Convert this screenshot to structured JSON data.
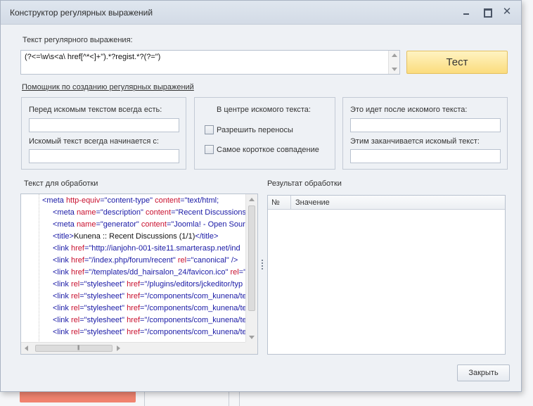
{
  "window": {
    "title": "Конструктор регулярных выражений"
  },
  "regex": {
    "label": "Текст регулярного выражения:",
    "value": "(?<=\\w\\s<a\\ href[^*<]+\").*?regist.*?(?=\")",
    "test_button": "Тест"
  },
  "helper": {
    "link": "Помощник по созданию регулярных выражений",
    "before_label": "Перед искомым текстом всегда есть:",
    "before_value": "",
    "starts_label": "Искомый текст всегда начинается с:",
    "starts_value": "",
    "center_label": "В центре искомого текста:",
    "allow_wrap_label": "Разрешить переносы",
    "shortest_match_label": "Самое короткое совпадение",
    "after_label": "Это идет после искомого текста:",
    "after_value": "",
    "ends_label": "Этим заканчивается искомый текст:",
    "ends_value": ""
  },
  "source": {
    "label": "Текст для обработки",
    "lines": [
      [
        [
          "    ",
          "t"
        ],
        [
          "<meta ",
          "tag"
        ],
        [
          "http-equiv",
          "attr"
        ],
        [
          "=\"content-type\" ",
          "val"
        ],
        [
          "content",
          "attr"
        ],
        [
          "=\"text/html;",
          "val"
        ]
      ],
      [
        [
          "<meta ",
          "tag"
        ],
        [
          "name",
          "attr"
        ],
        [
          "=\"description\" ",
          "val"
        ],
        [
          "content",
          "attr"
        ],
        [
          "=\"Recent Discussions (",
          "val"
        ]
      ],
      [
        [
          "<meta ",
          "tag"
        ],
        [
          "name",
          "attr"
        ],
        [
          "=\"generator\" ",
          "val"
        ],
        [
          "content",
          "attr"
        ],
        [
          "=\"Joomla! - Open Sourc",
          "val"
        ]
      ],
      [
        [
          "<title>",
          "tag"
        ],
        [
          "Kunena :: Recent Discussions (1/1)",
          "t"
        ],
        [
          "</title>",
          "tag"
        ]
      ],
      [
        [
          "<link ",
          "tag"
        ],
        [
          "href",
          "attr"
        ],
        [
          "=\"http://ianjohn-001-site11.smarterasp.net/ind",
          "val"
        ]
      ],
      [
        [
          "<link ",
          "tag"
        ],
        [
          "href",
          "attr"
        ],
        [
          "=\"/index.php/forum/recent\" ",
          "val"
        ],
        [
          "rel",
          "attr"
        ],
        [
          "=\"canonical\" />",
          "val"
        ]
      ],
      [
        [
          "<link ",
          "tag"
        ],
        [
          "href",
          "attr"
        ],
        [
          "=\"/templates/dd_hairsalon_24/favicon.ico\" ",
          "val"
        ],
        [
          "rel",
          "attr"
        ],
        [
          "=\"",
          "val"
        ]
      ],
      [
        [
          "<link ",
          "tag"
        ],
        [
          "rel",
          "attr"
        ],
        [
          "=\"stylesheet\" ",
          "val"
        ],
        [
          "href",
          "attr"
        ],
        [
          "=\"/plugins/editors/jckeditor/typ",
          "val"
        ]
      ],
      [
        [
          "<link ",
          "tag"
        ],
        [
          "rel",
          "attr"
        ],
        [
          "=\"stylesheet\" ",
          "val"
        ],
        [
          "href",
          "attr"
        ],
        [
          "=\"/components/com_kunena/te",
          "val"
        ]
      ],
      [
        [
          "<link ",
          "tag"
        ],
        [
          "rel",
          "attr"
        ],
        [
          "=\"stylesheet\" ",
          "val"
        ],
        [
          "href",
          "attr"
        ],
        [
          "=\"/components/com_kunena/te",
          "val"
        ]
      ],
      [
        [
          "<link ",
          "tag"
        ],
        [
          "rel",
          "attr"
        ],
        [
          "=\"stylesheet\" ",
          "val"
        ],
        [
          "href",
          "attr"
        ],
        [
          "=\"/components/com_kunena/te",
          "val"
        ]
      ],
      [
        [
          "<link ",
          "tag"
        ],
        [
          "rel",
          "attr"
        ],
        [
          "=\"stylesheet\" ",
          "val"
        ],
        [
          "href",
          "attr"
        ],
        [
          "=\"/components/com_kunena/te",
          "val"
        ]
      ]
    ]
  },
  "result": {
    "label": "Результат обработки",
    "col_num": "№",
    "col_value": "Значение"
  },
  "footer": {
    "close_button": "Закрыть"
  },
  "colors": {
    "tag": "#1a1aa6",
    "attr": "#c8102e",
    "value": "#1a1aa6",
    "accent_button": "#fbdc7d"
  }
}
